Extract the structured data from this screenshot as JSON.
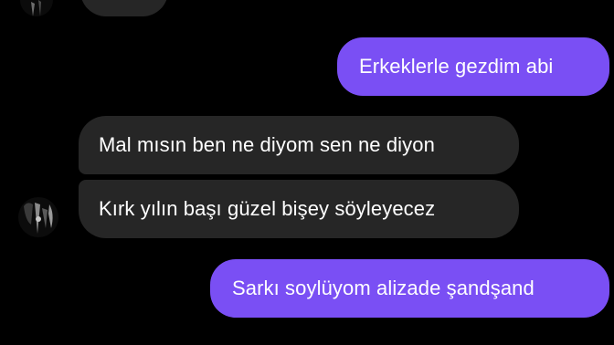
{
  "messages": [
    {
      "id": "m1",
      "direction": "outgoing",
      "text": "Erkeklerle gezdim abi"
    },
    {
      "id": "m2",
      "direction": "incoming",
      "text": "Mal mısın ben ne diyom sen ne diyon"
    },
    {
      "id": "m3",
      "direction": "incoming",
      "text": "Kırk yılın başı güzel bişey söyleyecez"
    },
    {
      "id": "m4",
      "direction": "outgoing",
      "text": "Sarkı soylüyom alizade şandşand"
    }
  ],
  "colors": {
    "background": "#000000",
    "outgoing_bubble": "#7a4ff4",
    "incoming_bubble": "#262626",
    "text": "#ffffff"
  }
}
